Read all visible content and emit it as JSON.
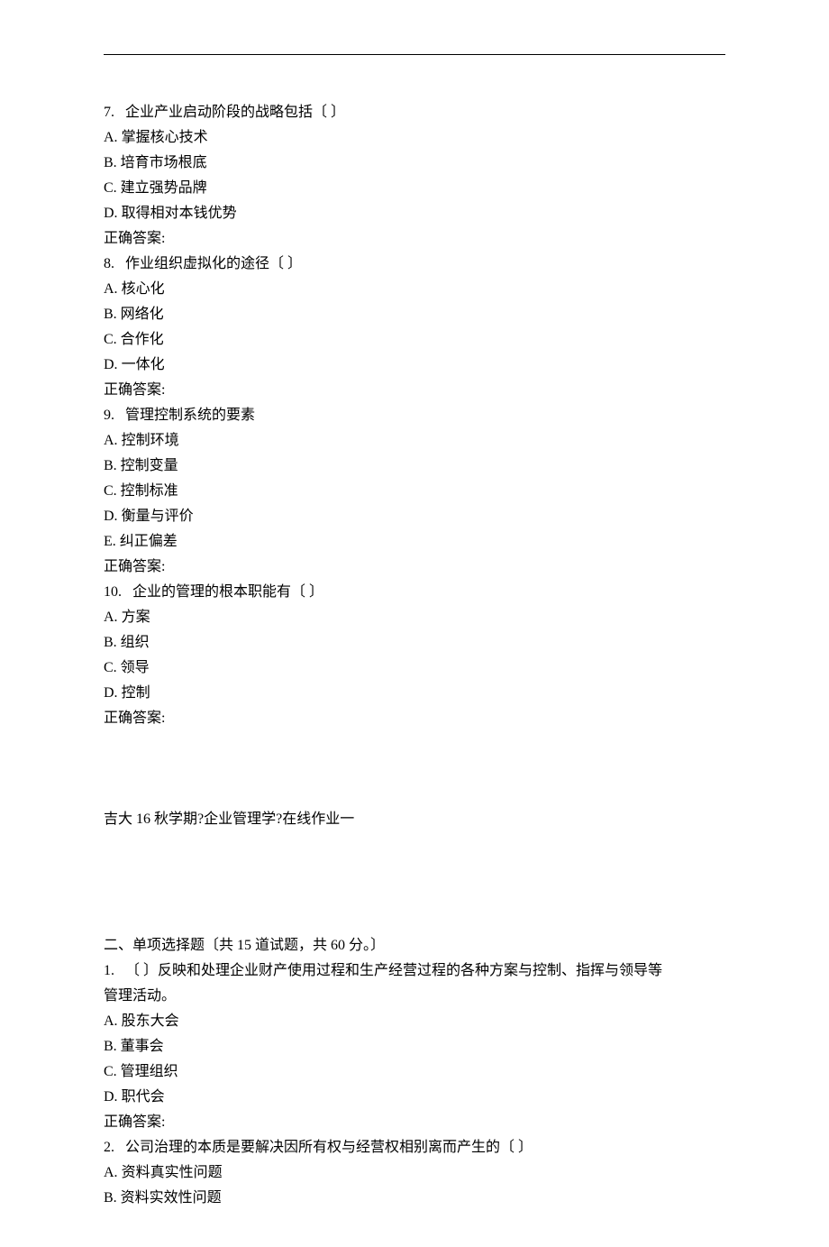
{
  "questions_top": [
    {
      "num": "7.",
      "stem": "企业产业启动阶段的战略包括〔 〕",
      "options": [
        {
          "letter": "A.",
          "text": "掌握核心技术"
        },
        {
          "letter": "B.",
          "text": "培育市场根底"
        },
        {
          "letter": "C.",
          "text": "建立强势品牌"
        },
        {
          "letter": "D.",
          "text": "取得相对本钱优势"
        }
      ],
      "answer_label": "正确答案:"
    },
    {
      "num": "8.",
      "stem": "作业组织虚拟化的途径〔 〕",
      "options": [
        {
          "letter": "A.",
          "text": "核心化"
        },
        {
          "letter": "B.",
          "text": "网络化"
        },
        {
          "letter": "C.",
          "text": "合作化"
        },
        {
          "letter": "D.",
          "text": "一体化"
        }
      ],
      "answer_label": "正确答案:"
    },
    {
      "num": "9.",
      "stem": "管理控制系统的要素",
      "options": [
        {
          "letter": "A.",
          "text": "控制环境"
        },
        {
          "letter": "B.",
          "text": "控制变量"
        },
        {
          "letter": "C.",
          "text": "控制标准"
        },
        {
          "letter": "D.",
          "text": "衡量与评价"
        },
        {
          "letter": "E.",
          "text": "纠正偏差"
        }
      ],
      "answer_label": "正确答案:"
    },
    {
      "num": "10.",
      "stem": "企业的管理的根本职能有〔 〕",
      "options": [
        {
          "letter": "A.",
          "text": "方案"
        },
        {
          "letter": "B.",
          "text": "组织"
        },
        {
          "letter": "C.",
          "text": "领导"
        },
        {
          "letter": "D.",
          "text": "控制"
        }
      ],
      "answer_label": "正确答案:"
    }
  ],
  "title_line_prefix": "吉大 ",
  "title_line_num": "16",
  "title_line_rest": " 秋学期?企业管理学?在线作业一",
  "section_header_prefix": "二、单项选择题〔共 ",
  "section_header_count": "15",
  "section_header_mid": " 道试题，共 ",
  "section_header_score": "60",
  "section_header_suffix": " 分。〕",
  "questions_bottom": [
    {
      "num": "1.",
      "stem_lines": [
        "〔 〕反映和处理企业财产使用过程和生产经营过程的各种方案与控制、指挥与领导等",
        "管理活动。"
      ],
      "options": [
        {
          "letter": "A.",
          "text": "股东大会"
        },
        {
          "letter": "B.",
          "text": "董事会"
        },
        {
          "letter": "C.",
          "text": "管理组织"
        },
        {
          "letter": "D.",
          "text": "职代会"
        }
      ],
      "answer_label": "正确答案:"
    },
    {
      "num": "2.",
      "stem_lines": [
        "公司治理的本质是要解决因所有权与经营权相别离而产生的〔 〕"
      ],
      "options": [
        {
          "letter": "A.",
          "text": "资料真实性问题"
        },
        {
          "letter": "B.",
          "text": "资料实效性问题"
        }
      ],
      "answer_label": ""
    }
  ]
}
